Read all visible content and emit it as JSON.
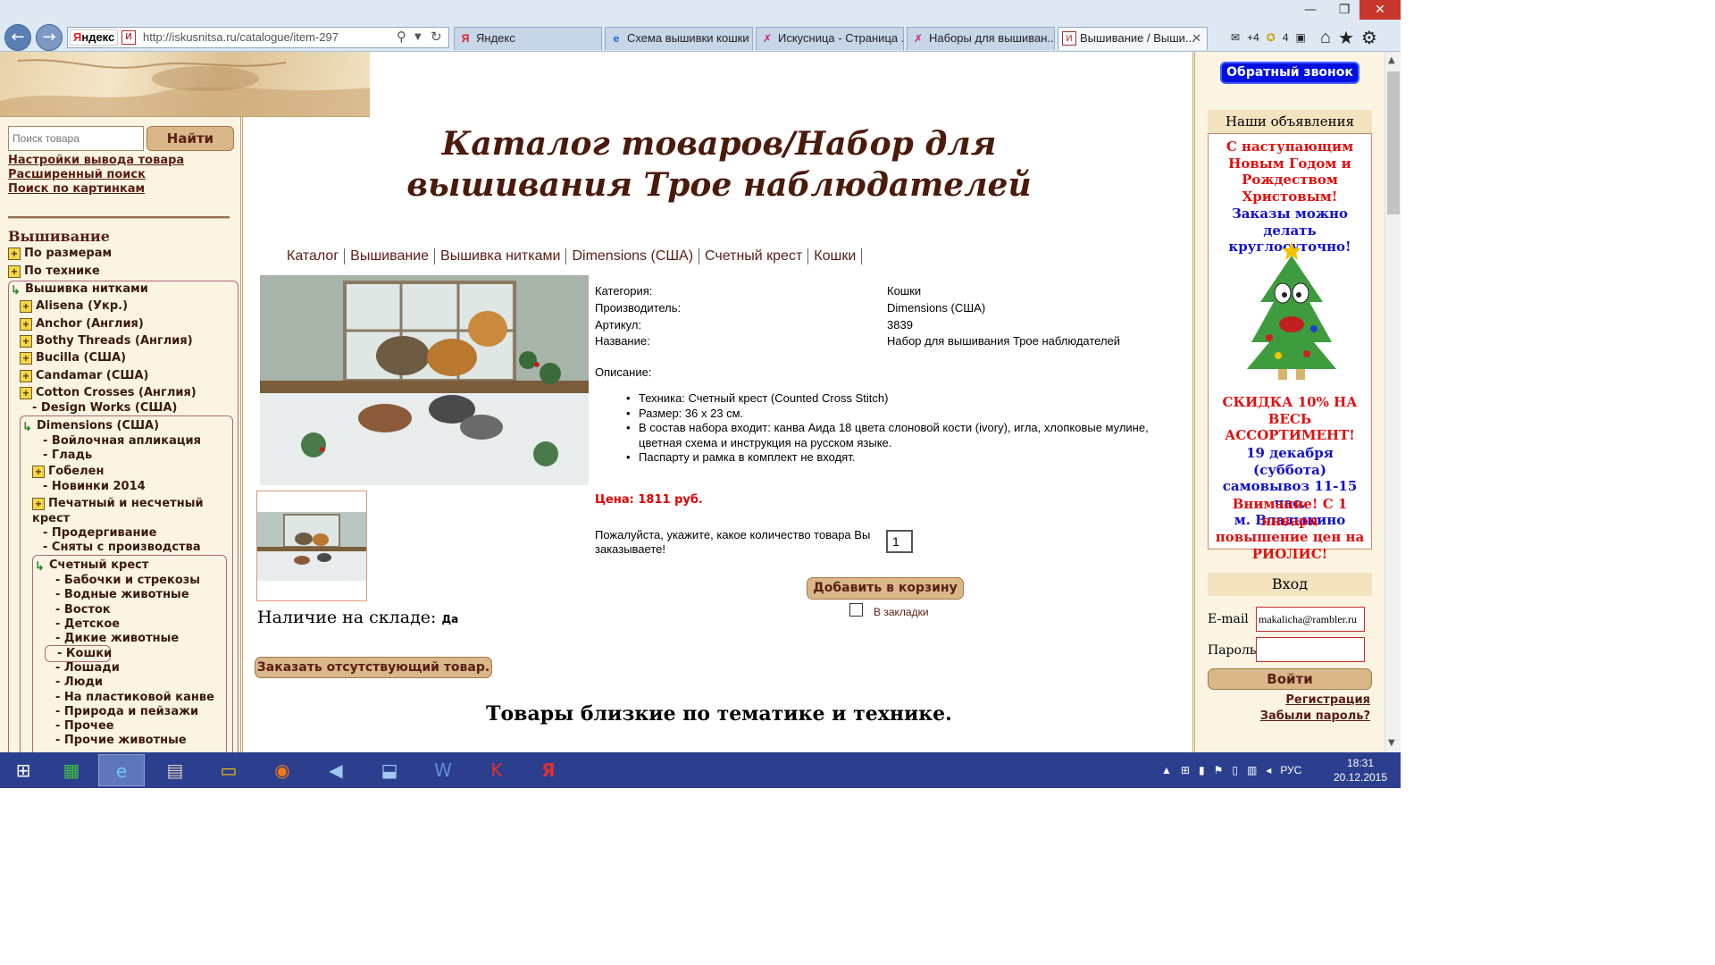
{
  "browser": {
    "address_logo_prefix": "Я",
    "address_logo_rest": "ндекс",
    "url": "http://iskusnitsa.ru/catalogue/item-297",
    "tabs": [
      {
        "label": "Яндекс",
        "icon": "Я"
      },
      {
        "label": "Схема вышивки кошки",
        "icon": "e"
      },
      {
        "label": "Искусница - Страница ...",
        "icon": "✗"
      },
      {
        "label": "Наборы для вышиван...",
        "icon": "✗"
      },
      {
        "label": "Вышивание / Выши...",
        "icon": "И"
      }
    ],
    "mail_count": "+4",
    "notif_count": "4"
  },
  "left": {
    "search_placeholder": "Поиск товара",
    "search_button": "Найти",
    "links": [
      "Настройки вывода товара",
      "Расширенный поиск",
      "Поиск по картинкам"
    ],
    "heading": "Вышивание",
    "tree": [
      "По размерам",
      "По технике",
      "Вышивка нитками",
      "Alisena (Укр.)",
      "Anchor (Англия)",
      "Bothy Threads (Англия)",
      "Bucilla (США)",
      "Candamar (США)",
      "Cotton Crosses (Англия)",
      "- Design Works (США)",
      "Dimensions (США)",
      "- Войлочная апликация",
      "- Гладь",
      "Гобелен",
      "- Новинки 2014",
      "Печатный и несчетный",
      "крест",
      "- Продергивание",
      "- Сняты с производства",
      "Счетный крест",
      "- Бабочки и стрекозы",
      "- Водные животные",
      "- Восток",
      "- Детское",
      "- Дикие животные",
      "- Кошки",
      "- Лошади",
      "- Люди",
      "- На пластиковой канве",
      "- Природа и пейзажи",
      "- Прочее",
      "- Прочие животные"
    ]
  },
  "main": {
    "title": "Каталог товаров/Набор для вышивания Трое наблюдателей",
    "breadcrumb": [
      "Каталог",
      "Вышивание",
      "Вышивка нитками",
      "Dimensions (США)",
      "Счетный крест",
      "Кошки"
    ],
    "specs": [
      {
        "label": "Категория:",
        "value": "Кошки"
      },
      {
        "label": "Производитель:",
        "value": "Dimensions (США)"
      },
      {
        "label": "Артикул:",
        "value": "3839"
      },
      {
        "label": "Название:",
        "value": "Набор для вышивания Трое наблюдателей"
      }
    ],
    "description_label": "Описание:",
    "description": [
      "Техника: Счетный крест (Counted Cross Stitch)",
      "Размер: 36 х 23 см.",
      "В состав набора входит: канва Аида 18 цвета слоновой кости (ivory), игла, хлопковые мулине, цветная схема и инструкция на русском языке.",
      "Паспарту и рамка в комплект не входят."
    ],
    "price": "Цена: 1811 руб.",
    "qty_label": "Пожалуйста, укажите, какое количество товара Вы заказываете!",
    "qty_value": "1",
    "add_to_cart": "Добавить в корзину",
    "bookmark": "В закладки",
    "stock_label": "Наличие на складе:",
    "stock_value": "Да",
    "order_missing": "Заказать отсутствующий товар.",
    "related": "Товары близкие по тематике и технике."
  },
  "right": {
    "callback": "Обратный звонок",
    "ads_heading": "Наши объявления",
    "ads_red1": [
      "С наступающим",
      "Новым Годом и",
      "Рождеством",
      "Христовым!"
    ],
    "ads_blue1": [
      "Заказы можно делать",
      "круглосуточно!"
    ],
    "ads_red2": [
      "СКИДКА 10% НА",
      "ВЕСЬ",
      "АССОРТИМЕНТ!"
    ],
    "ads_blue2": [
      "19 декабря (суббота)",
      "самовывоз 11-15 час.",
      "м. Владыкино"
    ],
    "ads_red3": [
      "Внимание! С 1 января",
      "повышение цен на",
      "РИОЛИС!"
    ],
    "login_heading": "Вход",
    "email_label": "E-mail",
    "email_value": "makalicha@rambler.ru",
    "password_label": "Пароль",
    "login_button": "Войти",
    "register": "Регистрация",
    "forgot": "Забыли пароль?"
  },
  "taskbar": {
    "lang": "РУС",
    "time": "18:31",
    "date": "20.12.2015"
  },
  "colors": {
    "accent_brown": "#5a1e12",
    "button_tan": "#d9b789",
    "price_red": "#e00000",
    "callback_blue": "#0010e0",
    "ad_red": "#e01010",
    "ad_blue": "#1010d0"
  }
}
